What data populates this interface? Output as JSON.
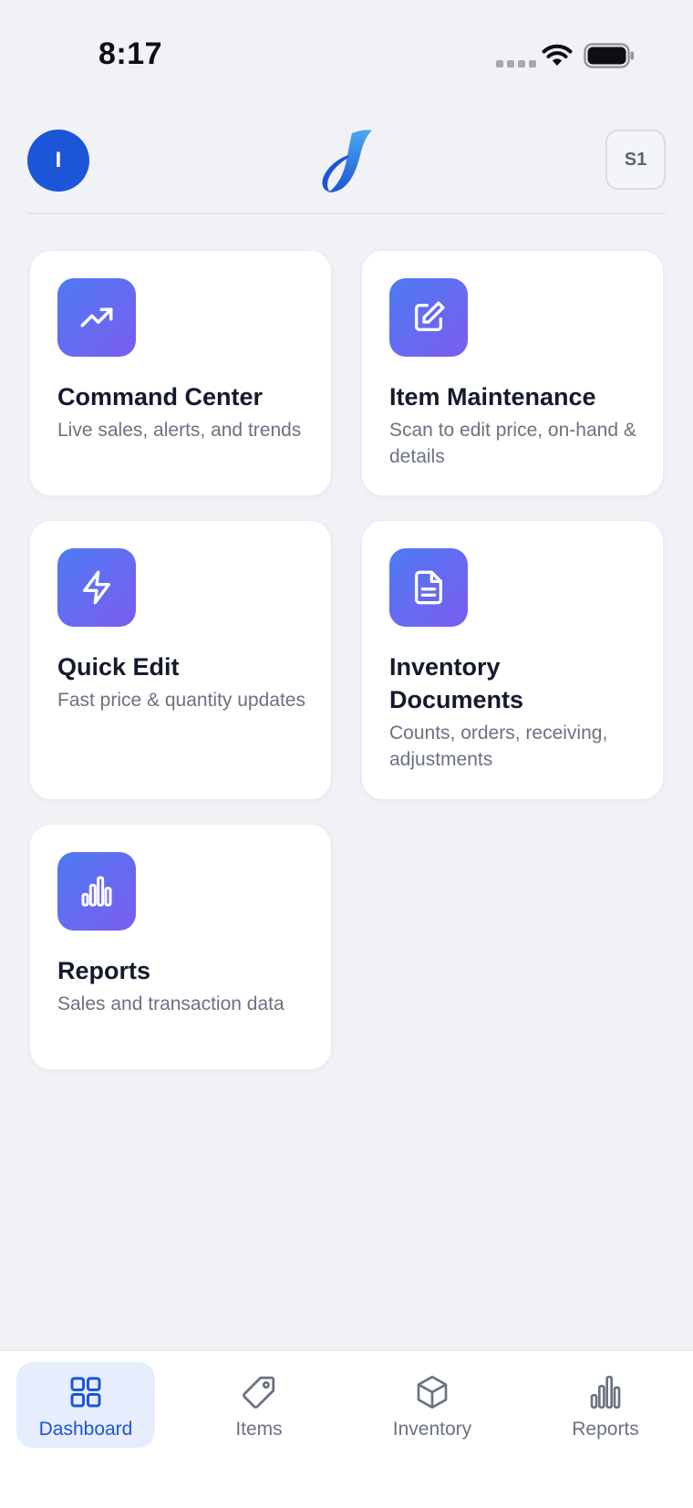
{
  "status_bar": {
    "time": "8:17"
  },
  "header": {
    "avatar_initial": "I",
    "store_code": "S1"
  },
  "cards": [
    {
      "title": "Command Center",
      "description": "Live sales, alerts, and trends",
      "icon": "trending-up-icon"
    },
    {
      "title": "Item Maintenance",
      "description": "Scan to edit price, on-hand & details",
      "icon": "edit-icon"
    },
    {
      "title": "Quick Edit",
      "description": "Fast price & quantity updates",
      "icon": "lightning-icon"
    },
    {
      "title": "Inventory Documents",
      "description": "Counts, orders, receiving, adjustments",
      "icon": "document-icon"
    },
    {
      "title": "Reports",
      "description": "Sales and transaction data",
      "icon": "bar-chart-icon"
    }
  ],
  "nav": {
    "items": [
      {
        "label": "Dashboard",
        "icon": "grid-icon",
        "active": true
      },
      {
        "label": "Items",
        "icon": "tag-icon",
        "active": false
      },
      {
        "label": "Inventory",
        "icon": "box-icon",
        "active": false
      },
      {
        "label": "Reports",
        "icon": "bar-chart-icon",
        "active": false
      }
    ]
  },
  "colors": {
    "accent": "#1d55d8",
    "icon_gradient_start": "#4d7bf3",
    "icon_gradient_end": "#7b5cf0",
    "background": "#f1f2f6"
  }
}
